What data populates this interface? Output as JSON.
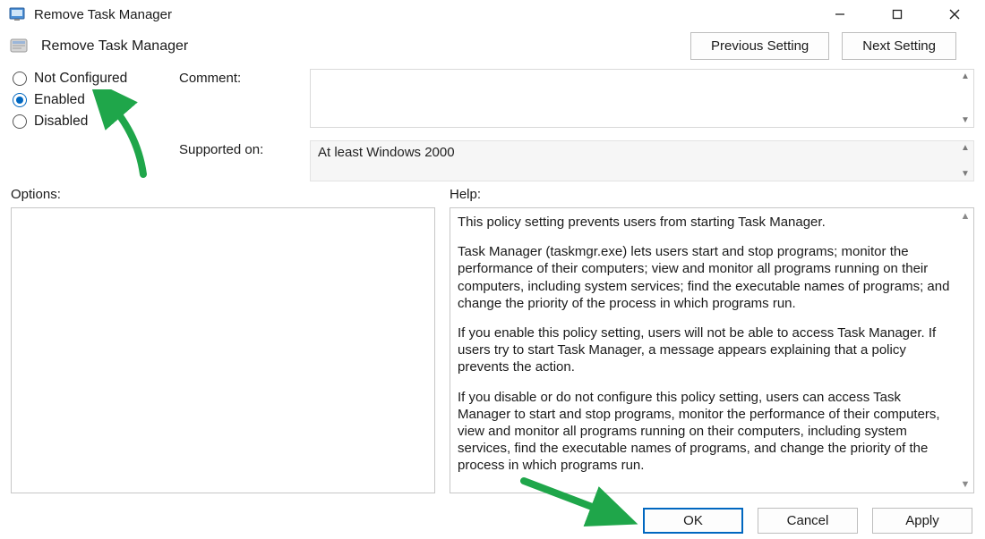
{
  "window": {
    "title": "Remove Task Manager"
  },
  "header": {
    "policy_name": "Remove Task Manager",
    "prev_label": "Previous Setting",
    "next_label": "Next Setting"
  },
  "radios": {
    "not_configured": "Not Configured",
    "enabled": "Enabled",
    "disabled": "Disabled",
    "selected": "enabled"
  },
  "fields": {
    "comment_label": "Comment:",
    "comment_value": "",
    "supported_label": "Supported on:",
    "supported_value": "At least Windows 2000"
  },
  "panes": {
    "options_label": "Options:",
    "help_label": "Help:"
  },
  "help": {
    "p1": "This policy setting prevents users from starting Task Manager.",
    "p2": "Task Manager (taskmgr.exe) lets users start and stop programs; monitor the performance of their computers; view and monitor all programs running on their computers, including system services; find the executable names of programs; and change the priority of the process in which programs run.",
    "p3": "If you enable this policy setting, users will not be able to access Task Manager. If users try to start Task Manager, a message appears explaining that a policy prevents the action.",
    "p4": "If you disable or do not configure this policy setting, users can access Task Manager to  start and stop programs, monitor the performance of their computers, view and monitor all programs running on their computers, including system services, find the executable names of programs, and change the priority of the process in which programs run."
  },
  "buttons": {
    "ok": "OK",
    "cancel": "Cancel",
    "apply": "Apply"
  },
  "annotation": {
    "arrow_color": "#1fa64a"
  }
}
